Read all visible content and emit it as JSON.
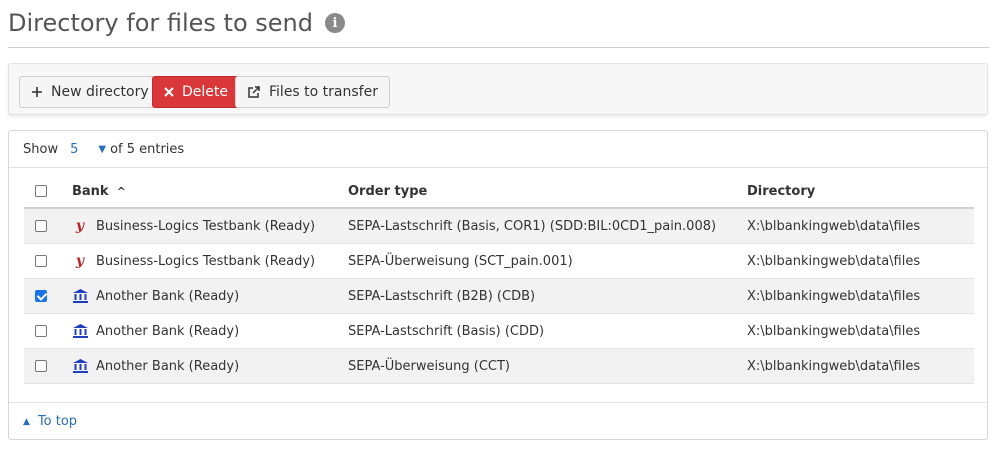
{
  "page": {
    "title": "Directory for files to send",
    "info_icon_glyph": "i"
  },
  "toolbar": {
    "new_directory_label": "New directory",
    "delete_label": "Delete",
    "files_to_transfer_label": "Files to transfer"
  },
  "paging": {
    "show_label": "Show",
    "page_size": "5",
    "of_entries": "of 5 entries"
  },
  "table": {
    "columns": {
      "bank": "Bank",
      "order_type": "Order type",
      "directory": "Directory"
    },
    "sort": {
      "column": "bank",
      "direction": "ascending"
    },
    "rows": [
      {
        "checked": false,
        "icon": "bl-logo-icon",
        "bank": "Business-Logics Testbank (Ready)",
        "order_type": "SEPA-Lastschrift (Basis, COR1) (SDD:BIL:0CD1_pain.008)",
        "directory": "X:\\blbankingweb\\data\\files"
      },
      {
        "checked": false,
        "icon": "bl-logo-icon",
        "bank": "Business-Logics Testbank (Ready)",
        "order_type": "SEPA-Überweisung (SCT_pain.001)",
        "directory": "X:\\blbankingweb\\data\\files"
      },
      {
        "checked": true,
        "icon": "bank-building-icon",
        "bank": "Another Bank (Ready)",
        "order_type": "SEPA-Lastschrift (B2B) (CDB)",
        "directory": "X:\\blbankingweb\\data\\files"
      },
      {
        "checked": false,
        "icon": "bank-building-icon",
        "bank": "Another Bank (Ready)",
        "order_type": "SEPA-Lastschrift (Basis) (CDD)",
        "directory": "X:\\blbankingweb\\data\\files"
      },
      {
        "checked": false,
        "icon": "bank-building-icon",
        "bank": "Another Bank (Ready)",
        "order_type": "SEPA-Überweisung (CCT)",
        "directory": "X:\\blbankingweb\\data\\files"
      }
    ]
  },
  "footer": {
    "to_top_label": "To top"
  },
  "colors": {
    "accent": "#2a6ebb",
    "danger": "#d9373a",
    "bl_logo": "#c0242b",
    "bank_icon": "#1f3fbf",
    "checkbox_checked": "#1a73e8"
  }
}
